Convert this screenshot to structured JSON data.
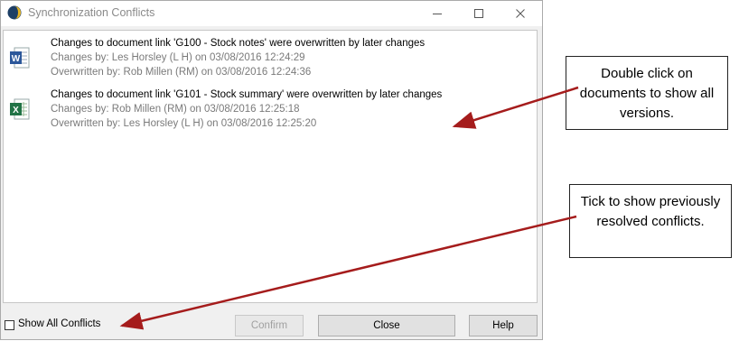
{
  "window": {
    "title": "Synchronization Conflicts",
    "controls": [
      "minimize-icon",
      "maximize-icon",
      "close-icon"
    ]
  },
  "conflicts": [
    {
      "icon": "word-document-icon",
      "headline": "Changes to document link 'G100 - Stock notes' were overwritten by later changes",
      "changes_by": "Changes by: Les Horsley (L H) on 03/08/2016 12:24:29",
      "overwritten_by": "Overwritten by: Rob Millen (RM) on 03/08/2016 12:24:36"
    },
    {
      "icon": "excel-document-icon",
      "headline": "Changes to document link 'G101 - Stock summary' were overwritten by later changes",
      "changes_by": "Changes by: Rob Millen (RM) on 03/08/2016 12:25:18",
      "overwritten_by": "Overwritten by: Les Horsley (L H) on 03/08/2016 12:25:20"
    }
  ],
  "footer": {
    "checkbox_label": "Show All Conflicts",
    "checkbox_checked": false,
    "confirm_label": "Confirm",
    "close_label": "Close",
    "help_label": "Help"
  },
  "callouts": {
    "documents": "Double click on documents to show all versions.",
    "resolved": "Tick to show previously resolved conflicts."
  },
  "colors": {
    "arrow": "#a51c1c",
    "word": "#2b579a",
    "excel": "#217346"
  }
}
